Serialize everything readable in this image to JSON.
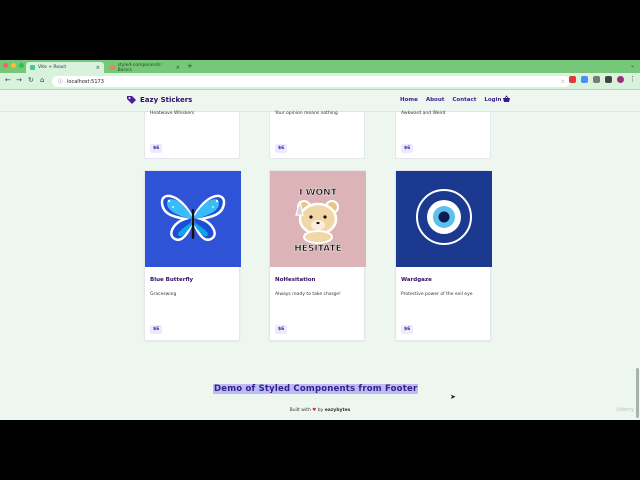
{
  "browser": {
    "tabs": [
      {
        "label": "Vite + React",
        "active": true
      },
      {
        "label": "styled-components: Basics",
        "active": false
      }
    ],
    "new_tab": "+",
    "url": "localhost:5173",
    "chrome_color": "#76c77a"
  },
  "header": {
    "logo_text": "Eazy Stickers",
    "nav": [
      "Home",
      "About",
      "Contact",
      "Login"
    ]
  },
  "top_row": [
    {
      "desc": "Heatwave Whiskers",
      "price": "$6"
    },
    {
      "desc": "Your opinion means nothing",
      "price": "$6"
    },
    {
      "desc": "Awkward and Weird",
      "price": "$6"
    }
  ],
  "products": [
    {
      "title": "Blue Butterfly",
      "desc": "Graceswing",
      "price": "$6",
      "image_icon": "butterfly-icon",
      "bg": "#2f53d6"
    },
    {
      "title": "NoHesitation",
      "desc": "Always ready to take charge!",
      "price": "$6",
      "image_icon": "bear-sticker-icon",
      "bg": "#dcb4b8",
      "sticker_text": "I WONT",
      "sticker_text2": "HESITATE"
    },
    {
      "title": "Wardgaze",
      "desc": "Protective power of the evil eye",
      "price": "$6",
      "image_icon": "evil-eye-icon",
      "bg": "#1b3a8f"
    }
  ],
  "footer": {
    "title": "Demo of Styled Components from Footer",
    "built_with": "Built with",
    "by": "by",
    "brand": "eazybytes"
  },
  "watermark": "Udemy",
  "colors": {
    "accent": "#3b1c8c",
    "page_bg": "#eef6f0",
    "highlight": "#b9bdf2"
  }
}
